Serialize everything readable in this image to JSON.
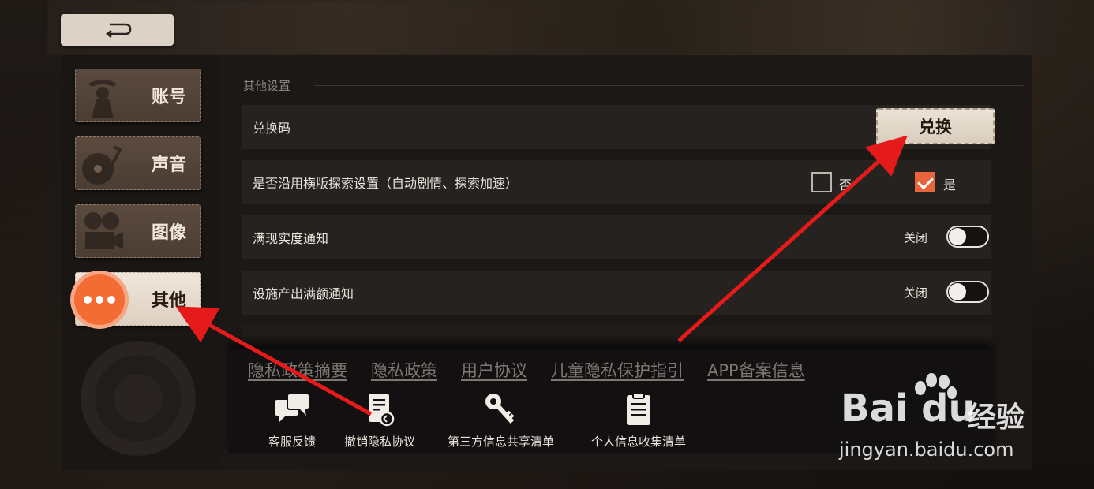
{
  "back_button": {
    "icon": "back-arrow-icon"
  },
  "sidebar": {
    "tabs": [
      {
        "label": "账号",
        "icon": "detective-icon",
        "active": false
      },
      {
        "label": "声音",
        "icon": "record-player-icon",
        "active": false
      },
      {
        "label": "图像",
        "icon": "film-camera-icon",
        "active": false
      },
      {
        "label": "其他",
        "icon": "more-dots-icon",
        "active": true
      }
    ]
  },
  "settings": {
    "section_title": "其他设置",
    "redeem": {
      "label": "兑换码",
      "button": "兑换"
    },
    "explore_setting": {
      "label": "是否沿用横版探索设置（自动剧情、探索加速）",
      "option_no": "否",
      "option_yes": "是",
      "selected": "是"
    },
    "notify_full": {
      "label": "满现实度通知",
      "state": "关闭"
    },
    "notify_facility": {
      "label": "设施产出满额通知",
      "state": "关闭"
    }
  },
  "footer": {
    "links": [
      "隐私政策摘要",
      "隐私政策",
      "用户协议",
      "儿童隐私保护指引",
      "APP备案信息"
    ],
    "buttons": [
      {
        "label": "客服反馈",
        "icon": "chat-bubbles-icon"
      },
      {
        "label": "撤销隐私协议",
        "icon": "revoke-document-icon"
      },
      {
        "label": "第三方信息共享清单",
        "icon": "key-icon"
      },
      {
        "label": "个人信息收集清单",
        "icon": "clipboard-icon"
      }
    ]
  },
  "watermark": {
    "logo": "Bai du",
    "cn": "经验",
    "url": "jingyan.baidu.com"
  },
  "colors": {
    "accent": "#f26c33",
    "annotation_red": "#e51b1b"
  }
}
